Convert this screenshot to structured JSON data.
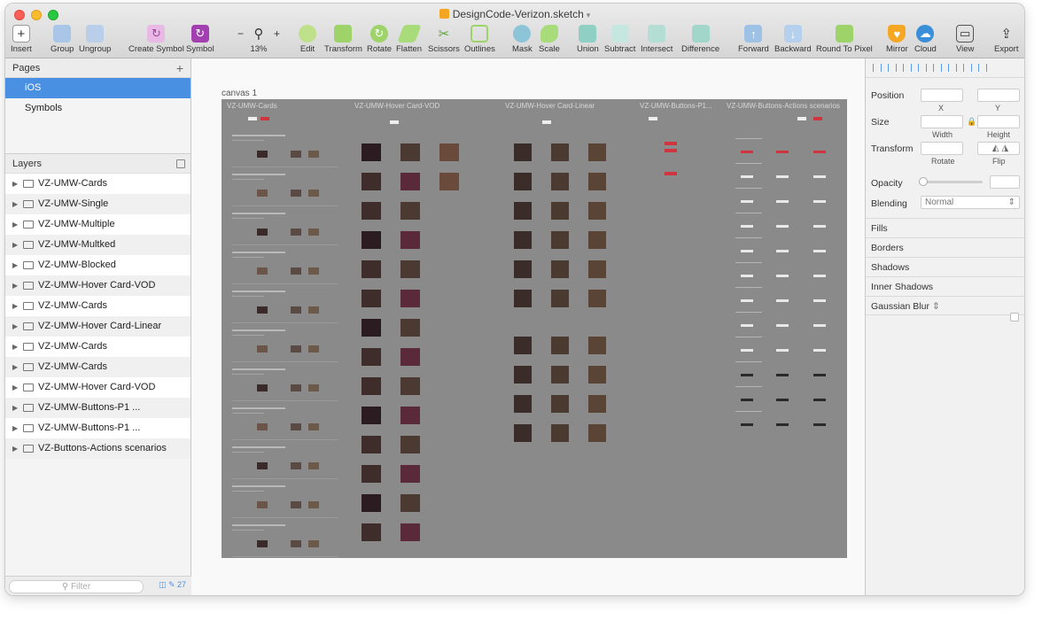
{
  "window": {
    "title": "DesignCode-Verizon.sketch"
  },
  "toolbar": {
    "items": [
      {
        "label": "Insert",
        "icon": "plus-icon"
      },
      {
        "label": "Group",
        "icon": "group-icon"
      },
      {
        "label": "Ungroup",
        "icon": "ungroup-icon"
      },
      {
        "label": "Create Symbol",
        "icon": "create-symbol-icon"
      },
      {
        "label": "Symbol",
        "icon": "symbol-icon"
      },
      {
        "label": "13%",
        "icon": "zoom-icon"
      },
      {
        "label": "Edit",
        "icon": "edit-icon"
      },
      {
        "label": "Transform",
        "icon": "transform-icon"
      },
      {
        "label": "Rotate",
        "icon": "rotate-icon"
      },
      {
        "label": "Flatten",
        "icon": "flatten-icon"
      },
      {
        "label": "Scissors",
        "icon": "scissors-icon"
      },
      {
        "label": "Outlines",
        "icon": "outlines-icon"
      },
      {
        "label": "Mask",
        "icon": "mask-icon"
      },
      {
        "label": "Scale",
        "icon": "scale-icon"
      },
      {
        "label": "Union",
        "icon": "union-icon"
      },
      {
        "label": "Subtract",
        "icon": "subtract-icon"
      },
      {
        "label": "Intersect",
        "icon": "intersect-icon"
      },
      {
        "label": "Difference",
        "icon": "difference-icon"
      },
      {
        "label": "Forward",
        "icon": "forward-icon"
      },
      {
        "label": "Backward",
        "icon": "backward-icon"
      },
      {
        "label": "Round To Pixel",
        "icon": "round-to-pixel-icon"
      },
      {
        "label": "Mirror",
        "icon": "mirror-icon"
      },
      {
        "label": "Cloud",
        "icon": "cloud-icon"
      },
      {
        "label": "View",
        "icon": "view-icon"
      },
      {
        "label": "Export",
        "icon": "export-icon"
      }
    ],
    "zoom_minus": "−",
    "zoom_plus": "+"
  },
  "pages": {
    "header": "Pages",
    "items": [
      {
        "label": "iOS",
        "selected": true
      },
      {
        "label": "Symbols",
        "selected": false
      }
    ]
  },
  "layers": {
    "header": "Layers",
    "items": [
      "VZ-UMW-Cards",
      "VZ-UMW-Single",
      "VZ-UMW-Multiple",
      "VZ-UMW-Multked",
      "VZ-UMW-Blocked",
      "VZ-UMW-Hover Card-VOD",
      "VZ-UMW-Cards",
      "VZ-UMW-Hover Card-Linear",
      "VZ-UMW-Cards",
      "VZ-UMW-Cards",
      "VZ-UMW-Hover Card-VOD",
      "VZ-UMW-Buttons-P1 ...",
      "VZ-UMW-Buttons-P1 ...",
      "VZ-Buttons-Actions scenarios"
    ],
    "filter_placeholder": "Filter",
    "count": "27"
  },
  "canvas": {
    "label": "canvas 1",
    "artboards": [
      "VZ-UMW-Cards",
      "VZ-UMW-Hover Card-VOD",
      "VZ-UMW-Hover Card-Linear",
      "VZ-UMW-Buttons-P1...",
      "VZ-UMW-Buttons-Actions scenarios"
    ]
  },
  "inspector": {
    "position_label": "Position",
    "x_label": "X",
    "y_label": "Y",
    "size_label": "Size",
    "width_label": "Width",
    "height_label": "Height",
    "transform_label": "Transform",
    "rotate_label": "Rotate",
    "flip_label": "Flip",
    "opacity_label": "Opacity",
    "blending_label": "Blending",
    "blending_value": "Normal",
    "sections": [
      "Fills",
      "Borders",
      "Shadows",
      "Inner Shadows",
      "Gaussian Blur"
    ]
  },
  "colors": {
    "selection": "#4a90e2",
    "artboard": "#8a8a8a",
    "accent_red": "#d0343e"
  }
}
